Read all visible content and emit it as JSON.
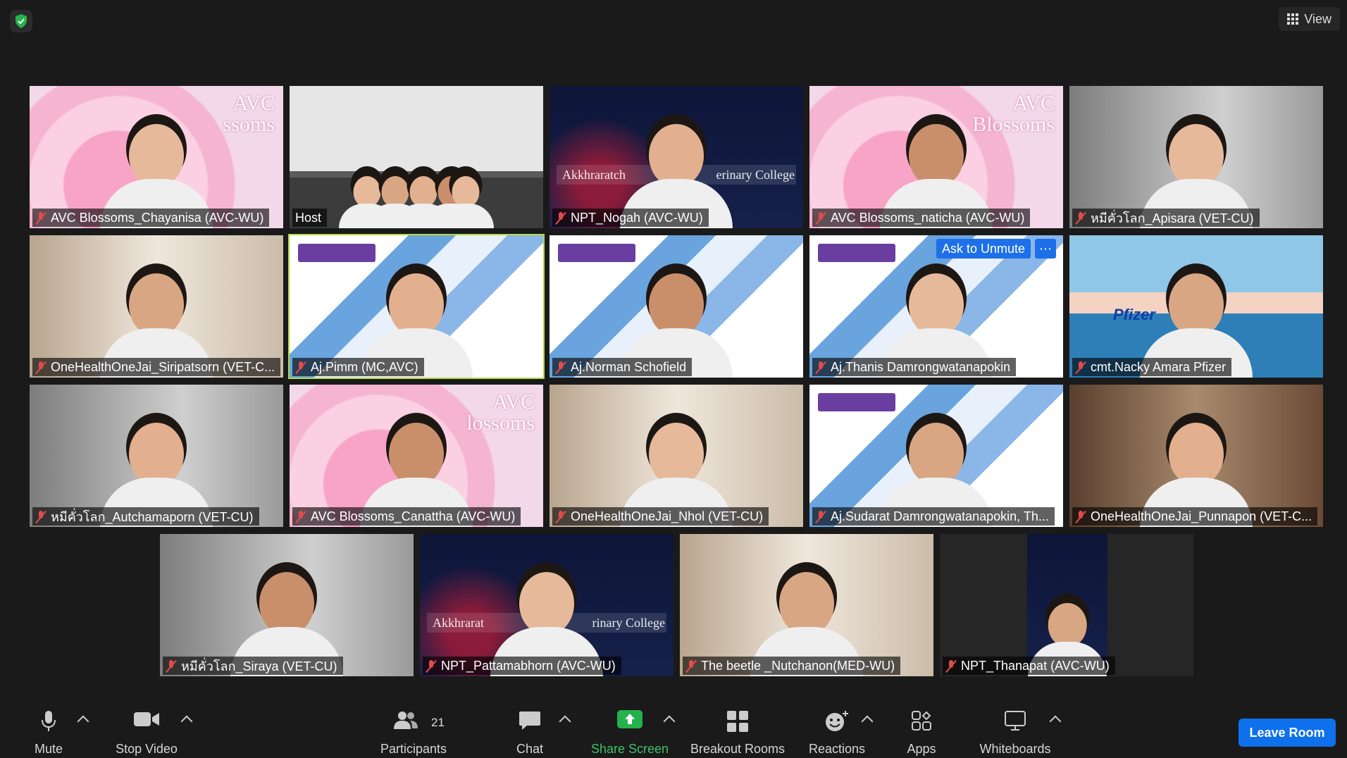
{
  "topbar": {
    "view_label": "View"
  },
  "tiles": [
    {
      "name": "AVC Blossoms_Chayanisa (AVC-WU)",
      "bg": "pink",
      "banner": "AVC\nssoms"
    },
    {
      "name": "Host",
      "bg": "room",
      "host": true
    },
    {
      "name": "NPT_Nogah (AVC-WU)",
      "bg": "navy",
      "banner_left": "Akkhraratch",
      "banner_right": "erinary College"
    },
    {
      "name": "AVC Blossoms_naticha (AVC-WU)",
      "bg": "pink",
      "banner": "AVC\nBlossoms"
    },
    {
      "name": "หมีคั่วโลก_Apisara (VET-CU)",
      "bg": "grey"
    },
    {
      "name": "OneHealthOneJai_Siripatsorn (VET-C...",
      "bg": "warm"
    },
    {
      "name": "Aj.Pimm (MC,AVC)",
      "bg": "wu",
      "active": true
    },
    {
      "name": "Aj.Norman Schofield",
      "bg": "wu"
    },
    {
      "name": "Aj.Thanis Damrongwatanapokin",
      "bg": "wu",
      "ask_unmute": "Ask to Unmute"
    },
    {
      "name": "cmt.Nacky Amara Pfizer",
      "bg": "sea",
      "brand": "Pfizer"
    },
    {
      "name": "หมีคั่วโลก_Autchamaporn (VET-CU)",
      "bg": "grey"
    },
    {
      "name": "AVC Blossoms_Canattha (AVC-WU)",
      "bg": "pink",
      "banner": "AVC\nlossoms"
    },
    {
      "name": "OneHealthOneJai_Nhol (VET-CU)",
      "bg": "warm"
    },
    {
      "name": "Aj.Sudarat Damrongwatanapokin, Th...",
      "bg": "wu"
    },
    {
      "name": "OneHealthOneJai_Punnapon (VET-C...",
      "bg": "brown"
    },
    {
      "name": "หมีคั่วโลก_Siraya (VET-CU)",
      "bg": "grey"
    },
    {
      "name": "NPT_Pattamabhorn (AVC-WU)",
      "bg": "navy",
      "banner_left": "Akkhrarat",
      "banner_right": "rinary College"
    },
    {
      "name": "The beetle _Nutchanon(MED-WU)",
      "bg": "warm"
    },
    {
      "name": "NPT_Thanapat (AVC-WU)",
      "bg": "navy_small"
    }
  ],
  "toolbar": {
    "mute": "Mute",
    "stop_video": "Stop Video",
    "participants": "Participants",
    "participants_count": "21",
    "chat": "Chat",
    "share_screen": "Share Screen",
    "breakout_rooms": "Breakout Rooms",
    "reactions": "Reactions",
    "apps": "Apps",
    "whiteboards": "Whiteboards",
    "leave": "Leave Room"
  },
  "colors": {
    "accent": "#0e71eb",
    "share_green": "#3cc267",
    "active_speaker": "#b4d93f",
    "muted_red": "#e24b4b"
  }
}
